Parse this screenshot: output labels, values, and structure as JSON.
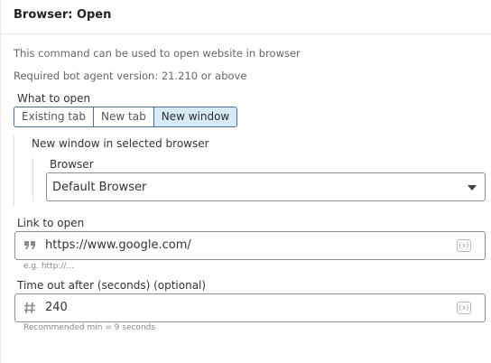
{
  "header": {
    "title": "Browser: Open"
  },
  "description": {
    "line1": "This command can be used to open website in browser",
    "line2": "Required bot agent version: 21.210 or above"
  },
  "what_to_open": {
    "label": "What to open",
    "options": [
      "Existing tab",
      "New tab",
      "New window"
    ],
    "selected": "New window"
  },
  "new_window": {
    "heading": "New window in selected browser",
    "browser_label": "Browser",
    "browser_value": "Default Browser"
  },
  "link": {
    "label": "Link to open",
    "value": "https://www.google.com/",
    "hint": "e.g. http://...",
    "icon": "quote-icon",
    "var_button": "{x}"
  },
  "timeout": {
    "label": "Time out after (seconds) (optional)",
    "value": "240",
    "hint": "Recommended min = 9 seconds",
    "icon": "number-icon",
    "var_button": "{x}"
  },
  "colors": {
    "segment_border": "#4b6d8f",
    "segment_active_bg": "#d6eaf8",
    "field_border": "#8f8f8f"
  }
}
